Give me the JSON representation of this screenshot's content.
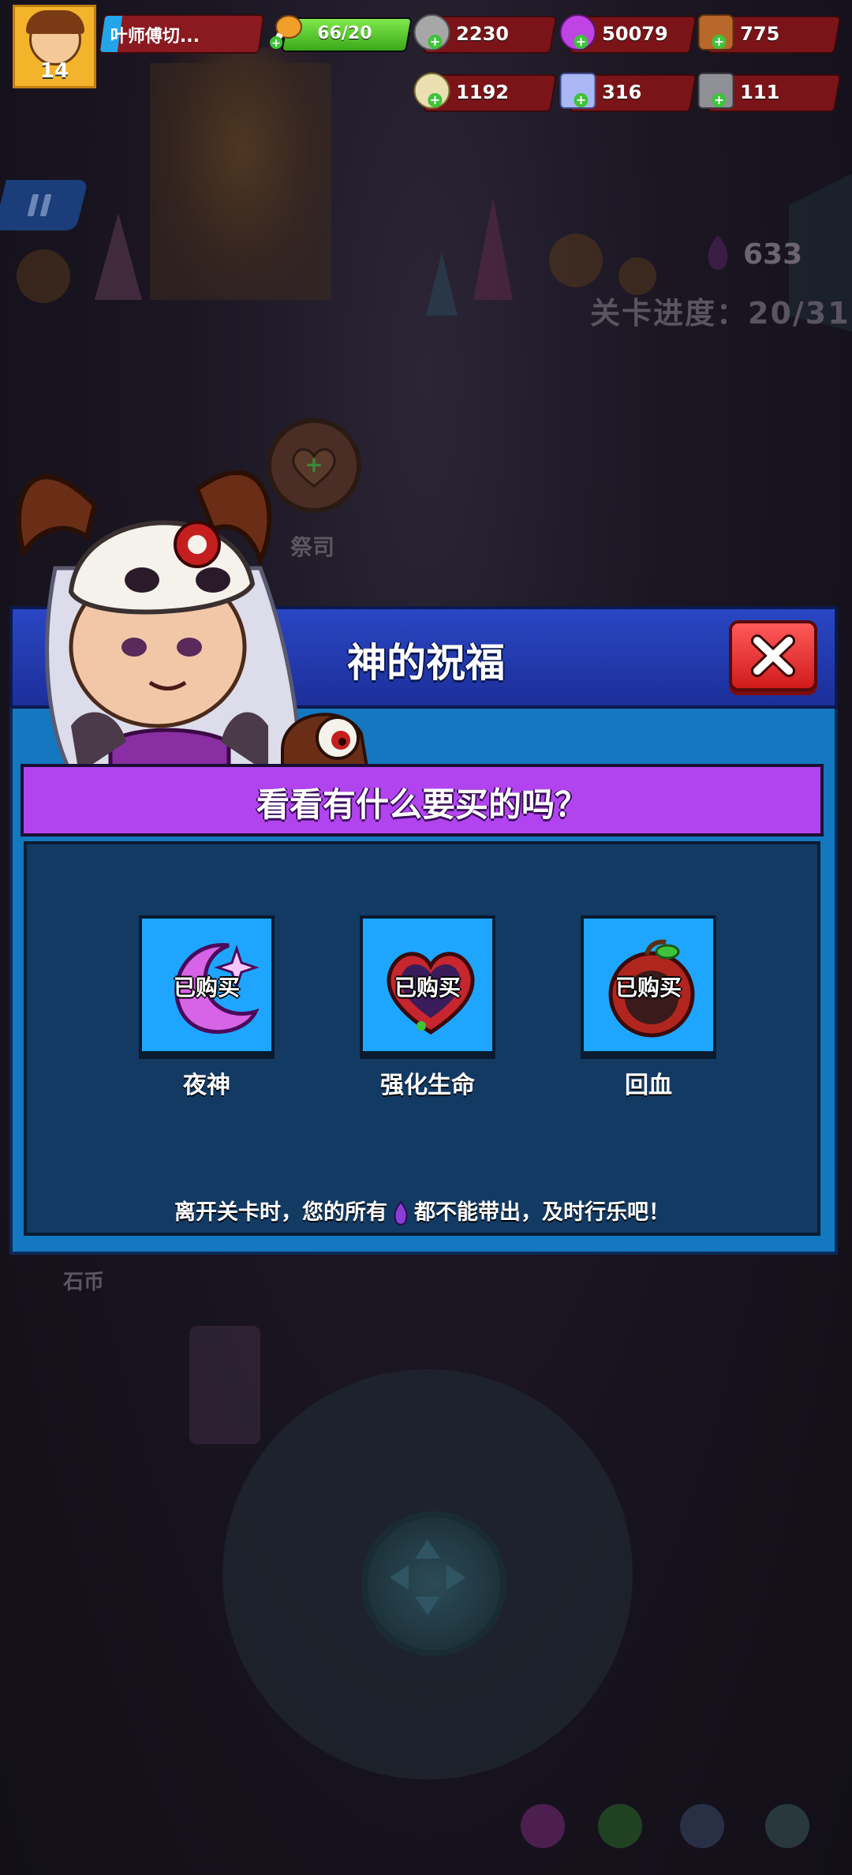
{
  "hud": {
    "player_level": "14",
    "player_name": "叶师傅切...",
    "energy": "66/20",
    "energy_fill_fraction": 1.0,
    "stone": "2230",
    "purple_orb": "50079",
    "wood": "775",
    "shell": "1192",
    "crystal": "316",
    "iron": "111"
  },
  "level": {
    "gem_count": "633",
    "progress_label": "关卡进度：20/31",
    "priest_label": "祭司",
    "coin_label": "石币"
  },
  "dialog": {
    "title": "神的祝福",
    "question": "看看有什么要买的吗？",
    "items": [
      {
        "name": "夜神",
        "status": "已购买",
        "icon": "moon-icon"
      },
      {
        "name": "强化生命",
        "status": "已购买",
        "icon": "heart-icon"
      },
      {
        "name": "回血",
        "status": "已购买",
        "icon": "apple-icon"
      }
    ],
    "footer_before": "离开关卡时，您的所有",
    "footer_after": "都不能带出，及时行乐吧！"
  },
  "colors": {
    "dialog_blue": "#1378bf",
    "header_blue": "#2a46c3",
    "question_purple": "#b244ef",
    "panel_navy": "#133a63",
    "close_red": "#d11b1b",
    "card_blue": "#1ea6ff"
  }
}
